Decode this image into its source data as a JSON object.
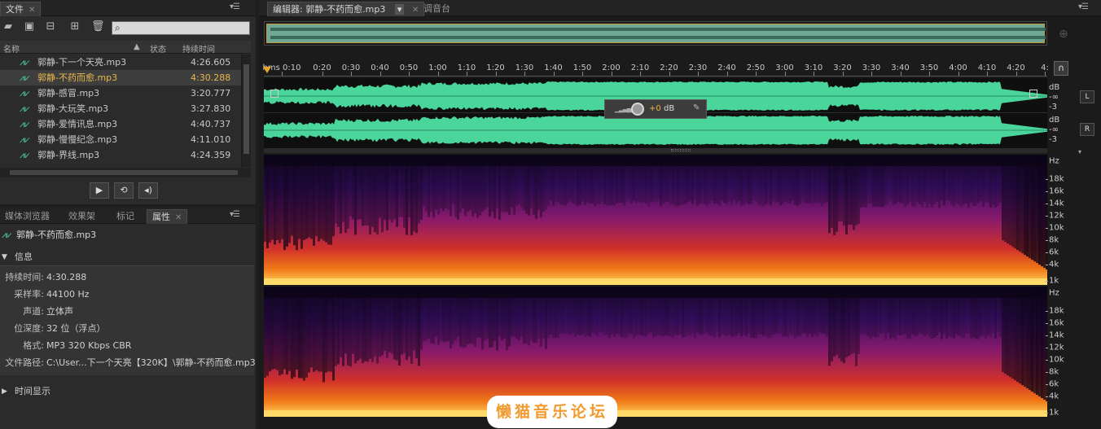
{
  "files_panel": {
    "tab_label": "文件",
    "search_value": "",
    "columns": {
      "name": "名称",
      "status": "状态",
      "duration": "持续时间"
    },
    "files": [
      {
        "name": "郭静-下一个天亮.mp3",
        "duration": "4:26.605",
        "selected": false
      },
      {
        "name": "郭静-不药而愈.mp3",
        "duration": "4:30.288",
        "selected": true
      },
      {
        "name": "郭静-感冒.mp3",
        "duration": "3:20.777",
        "selected": false
      },
      {
        "name": "郭静-大玩笑.mp3",
        "duration": "3:27.830",
        "selected": false
      },
      {
        "name": "郭静-爱情讯息.mp3",
        "duration": "4:40.737",
        "selected": false
      },
      {
        "name": "郭静-慢慢纪念.mp3",
        "duration": "4:11.010",
        "selected": false
      },
      {
        "name": "郭静-界线.mp3",
        "duration": "4:24.359",
        "selected": false
      }
    ]
  },
  "props_panel": {
    "tabs": [
      "媒体浏览器",
      "效果架",
      "标记",
      "属性"
    ],
    "active_tab": "属性",
    "file_name": "郭静-不药而愈.mp3",
    "info_header": "信息",
    "info": [
      {
        "key": "持续时间:",
        "value": "4:30.288"
      },
      {
        "key": "采样率:",
        "value": "44100 Hz"
      },
      {
        "key": "声道:",
        "value": "立体声"
      },
      {
        "key": "位深度:",
        "value": "32 位（浮点）"
      },
      {
        "key": "格式:",
        "value": "MP3 320 Kbps CBR"
      },
      {
        "key": "文件路径:",
        "value": "C:\\User...下一个天亮【320K】\\郭静-不药而愈.mp3"
      }
    ],
    "time_display_header": "时间显示"
  },
  "editor": {
    "tab_label": "编辑器: 郭静-不药而愈.mp3",
    "mixer_tab_label": "调音台",
    "ruler_labels": [
      "hms 0:10",
      "0:20",
      "0:30",
      "0:40",
      "0:50",
      "1:00",
      "1:10",
      "1:20",
      "1:30",
      "1:40",
      "1:50",
      "2:00",
      "2:10",
      "2:20",
      "2:30",
      "2:40",
      "2:50",
      "3:00",
      "3:10",
      "3:20",
      "3:30",
      "3:40",
      "3:50",
      "4:00",
      "4:10",
      "4:20",
      "4:"
    ],
    "volume_value": "+0",
    "volume_unit": "dB",
    "db_labels": [
      "dB",
      "-∞",
      "-3"
    ],
    "channel_left": "L",
    "channel_right": "R",
    "hz_labels": [
      "Hz",
      "18k",
      "16k",
      "14k",
      "12k",
      "10k",
      "8k",
      "6k",
      "4k",
      "1k"
    ],
    "colors": {
      "waveform": "#4ad69b",
      "accent": "#e6a72a"
    }
  },
  "watermark": "懒猫音乐论坛"
}
